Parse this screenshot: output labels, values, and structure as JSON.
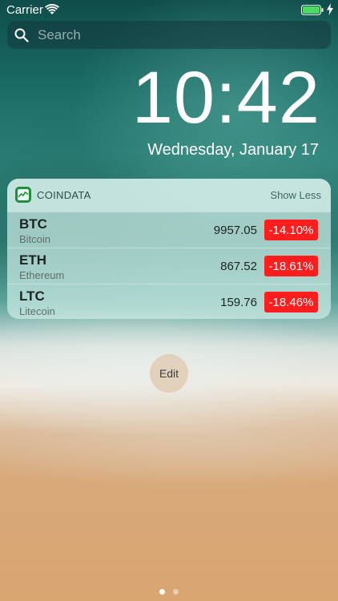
{
  "status_bar": {
    "carrier": "Carrier",
    "icons": [
      "wifi-icon",
      "battery-icon",
      "charging-bolt-icon"
    ]
  },
  "search": {
    "placeholder": "Search",
    "icon": "search-icon"
  },
  "lock_screen": {
    "time": "10:42",
    "date": "Wednesday, January 17"
  },
  "widget": {
    "app_name": "COINDATA",
    "app_icon": "chart-line-icon",
    "toggle_label": "Show Less",
    "negative_color": "#ff1d1d",
    "rows": [
      {
        "symbol": "BTC",
        "name": "Bitcoin",
        "price": "9957.05",
        "change": "-14.10%"
      },
      {
        "symbol": "ETH",
        "name": "Ethereum",
        "price": "867.52",
        "change": "-18.61%"
      },
      {
        "symbol": "LTC",
        "name": "Litecoin",
        "price": "159.76",
        "change": "-18.46%"
      }
    ]
  },
  "edit_button": {
    "label": "Edit"
  },
  "page_indicator": {
    "pages": 2,
    "current": 1
  }
}
